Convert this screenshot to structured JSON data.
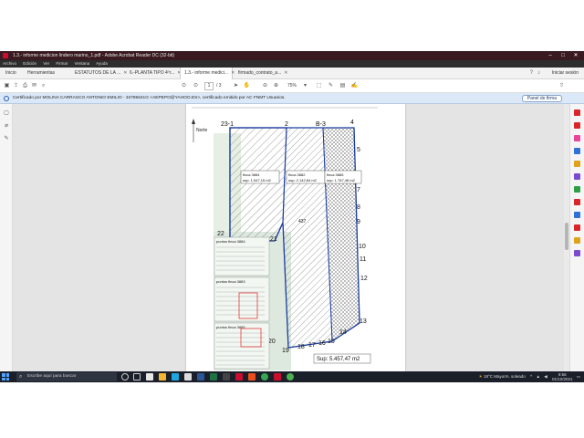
{
  "window": {
    "title": "1.3.- informe medicion lindero marino_1.pdf - Adobe Acrobat Reader DC (32-bit)",
    "menu": [
      "Archivo",
      "Edición",
      "Ver",
      "Firmar",
      "Ventana",
      "Ayuda"
    ],
    "tabs": [
      {
        "label": "Inicio"
      },
      {
        "label": "Herramientas"
      },
      {
        "label": "ESTATUTOS DE LA ..."
      },
      {
        "label": "6.-PLANTA TIPO 4ºr..."
      },
      {
        "label": "1.3.- informe medici..."
      },
      {
        "label": "firmado_contrato_a..."
      }
    ],
    "signin_label": "Iniciar sesión",
    "page_current": "1",
    "page_total": "/ 3",
    "zoom": "75%"
  },
  "infobar": {
    "text": "Certificado por MOLINA CARRASCO ANTONIO EMILIO - 34785641G <AEPEPO@YAHOO.ES>, certificado emitido por AC FNMT Usuarios.",
    "button": "Panel de firma"
  },
  "drawing": {
    "north_label": "Norte",
    "corner_labels": [
      "23-1",
      "2",
      "B-3",
      "4",
      "5",
      "6",
      "7",
      "8",
      "9",
      "10",
      "11",
      "12",
      "13",
      "14",
      "15",
      "16",
      "17",
      "18",
      "19",
      "20",
      "21",
      "22"
    ],
    "plots": [
      {
        "name": "finca 3884",
        "area": "sup: 1.547,15 m2"
      },
      {
        "name": "finca 3882",
        "area": "sup: 2.142,84 m2"
      },
      {
        "name": "finca 3885",
        "area": "sup: 1.767,48 m2"
      }
    ],
    "mid_label": "437",
    "total_area": "Sup: 5.457,47 m2",
    "table_title_1": "puntos finca 3884",
    "table_title_2": "puntos finca 3883",
    "table_title_3": "puntos finca 3885"
  },
  "taskbar": {
    "search_placeholder": "Escribe aquí para buscar",
    "weather": "18°C  Mayorm. soleado",
    "time": "9:56",
    "date": "01/10/2021"
  },
  "colors": {
    "titlebar": "#3a1a22",
    "infobar": "#dbe8f7",
    "boundary": "#1f3fa0",
    "taskbar": "#1b1f2a"
  }
}
